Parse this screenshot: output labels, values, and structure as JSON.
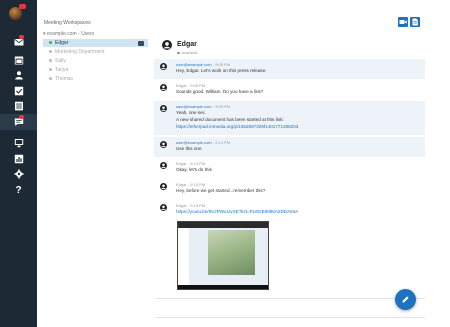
{
  "colors": {
    "rail_bg": "#1d2a36",
    "accent": "#1e73be",
    "selected_bg": "#cfe3f1",
    "shaded_msg": "#eef3f9",
    "badge": "#e53935"
  },
  "rail": {
    "items": [
      {
        "icon": "mail-icon",
        "badge": true
      },
      {
        "icon": "calendar-icon",
        "badge": false
      },
      {
        "icon": "contacts-icon",
        "badge": false
      },
      {
        "icon": "tasks-icon",
        "badge": false
      },
      {
        "icon": "notes-icon",
        "badge": false
      },
      {
        "icon": "chat-icon",
        "badge": true,
        "active": true
      },
      {
        "icon": "monitor-icon",
        "badge": false
      },
      {
        "icon": "stats-icon",
        "badge": false
      },
      {
        "icon": "settings-icon",
        "badge": false
      },
      {
        "icon": "help-icon",
        "badge": false
      }
    ],
    "help_label": "?"
  },
  "panel": {
    "workspace_title": "Meeting Workspaces",
    "tree_head": "▾ example.com - Users",
    "users": [
      {
        "name": "Edgar",
        "selected": true
      },
      {
        "name": "Marketing Department",
        "selected": false
      },
      {
        "name": "Sally",
        "selected": false
      },
      {
        "name": "Tanya",
        "selected": false
      },
      {
        "name": "Thomas",
        "selected": false
      }
    ]
  },
  "chat": {
    "name": "Edgar",
    "status": "Available",
    "messages": [
      {
        "sender": "user@example.com",
        "time": "- 9:05 PM",
        "lines": [
          "Hey, Edgar. Let's work on this press release."
        ],
        "shaded": true
      },
      {
        "sender": "Edgar",
        "time": "- 9:05 PM",
        "lines": [
          "Sounds good, William. Do you have a link?"
        ],
        "shaded": false
      },
      {
        "sender": "user@example.com",
        "time": "- 9:09 PM",
        "lines": [
          "Yeah, one sec.",
          "A new shared document has been started at this link:"
        ],
        "link": "https://etherpad.inmedia.org/p/1552897329f1401771396203",
        "shaded": true
      },
      {
        "sender": "user@example.com",
        "time": "- 9:14 PM",
        "lines": [
          "Use this one"
        ],
        "shaded": true
      },
      {
        "sender": "Edgar",
        "time": "- 9:14 PM",
        "lines": [
          "Okay, let's do this"
        ],
        "shaded": false
      },
      {
        "sender": "Edgar",
        "time": "- 9:15 PM",
        "lines": [
          "Hey, before we get started...remember this?"
        ],
        "shaded": false
      },
      {
        "sender": "Edgar",
        "time": "- 9:15 PM",
        "lines": [],
        "link": "https://youtu.be/9VJPWu1tvXE?list=PLEDE8088A2DDA84A",
        "shaded": false
      }
    ]
  }
}
